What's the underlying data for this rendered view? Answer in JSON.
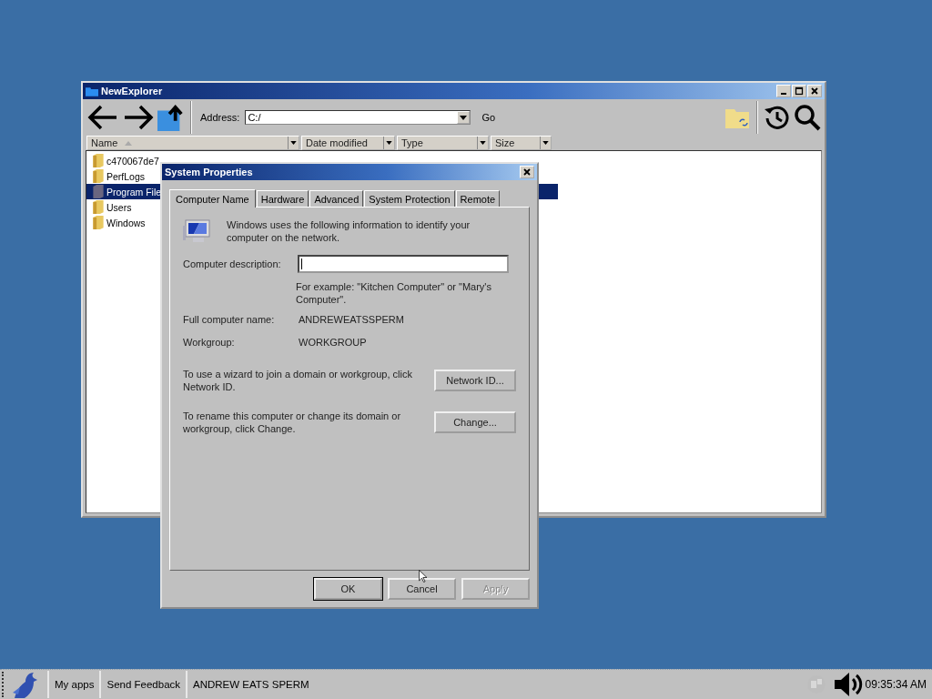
{
  "explorer": {
    "title": "NewExplorer",
    "address_label": "Address:",
    "address": "C:/",
    "go": "Go",
    "columns": [
      {
        "label": "Name",
        "sorted": true
      },
      {
        "label": "Date modified",
        "sorted": false
      },
      {
        "label": "Type",
        "sorted": false
      },
      {
        "label": "Size",
        "sorted": false
      }
    ],
    "rows": [
      {
        "name": "c470067de7",
        "kind": "folder",
        "selected": false
      },
      {
        "name": "PerfLogs",
        "kind": "folder",
        "selected": false
      },
      {
        "name": "Program File",
        "kind": "system",
        "selected": true
      },
      {
        "name": "Users",
        "kind": "folder",
        "selected": false
      },
      {
        "name": "Windows",
        "kind": "folder",
        "selected": false
      }
    ]
  },
  "dialog": {
    "title": "System Properties",
    "tabs": [
      {
        "label": "Computer Name",
        "selected": true
      },
      {
        "label": "Hardware",
        "selected": false
      },
      {
        "label": "Advanced",
        "selected": false
      },
      {
        "label": "System Protection",
        "selected": false
      },
      {
        "label": "Remote",
        "selected": false
      }
    ],
    "intro": "Windows uses the following information to identify your computer on the network.",
    "description_label": "Computer description:",
    "example": "For example: \"Kitchen Computer\" or \"Mary's Computer\".",
    "fields": [
      {
        "label": "Full computer name:",
        "value": "ANDREWEATSSPERM"
      },
      {
        "label": "Workgroup:",
        "value": "WORKGROUP"
      }
    ],
    "actions": [
      {
        "text": "To use a wizard to join a domain or workgroup, click Network ID.",
        "button": "Network ID..."
      },
      {
        "text": "To rename this computer or change its domain or workgroup, click Change.",
        "button": "Change..."
      }
    ],
    "buttons": [
      {
        "label": "OK",
        "disabled": false,
        "default": true
      },
      {
        "label": "Cancel",
        "disabled": false,
        "default": false
      },
      {
        "label": "Apply",
        "disabled": true,
        "default": false
      }
    ]
  },
  "taskbar": {
    "items": [
      "My apps",
      "Send Feedback",
      "ANDREW EATS SPERM"
    ],
    "clock": "09:35:34 AM"
  }
}
